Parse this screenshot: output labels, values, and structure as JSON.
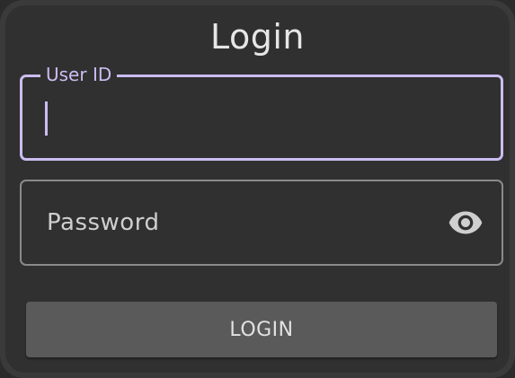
{
  "dialog": {
    "title": "Login"
  },
  "fields": {
    "user_id": {
      "label": "User ID",
      "value": ""
    },
    "password": {
      "placeholder": "Password",
      "value": "",
      "toggle_icon": "eye-icon"
    }
  },
  "actions": {
    "login_label": "LOGIN"
  },
  "colors": {
    "accent": "#cbbcf0",
    "card_bg": "#303030",
    "button_bg": "#5a5a5a"
  }
}
